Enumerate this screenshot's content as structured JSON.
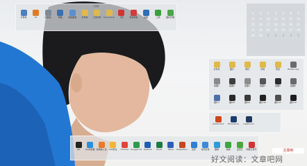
{
  "top_fence": {
    "title": "计算机",
    "icons": [
      {
        "label": "计算机",
        "icon": "computer-icon",
        "color": "#4a7fc1"
      },
      {
        "label": "IE",
        "icon": "browser-icon",
        "color": "#e27b24"
      },
      {
        "label": "回收站",
        "icon": "recycle-bin-icon",
        "color": "#7d8a96"
      },
      {
        "label": "网络",
        "icon": "network-icon",
        "color": "#3d6fb0"
      },
      {
        "label": "控制面板",
        "icon": "control-panel-icon",
        "color": "#5a8fd0"
      },
      {
        "label": "文件夹",
        "icon": "folder-icon",
        "color": "#e0b94a"
      },
      {
        "label": "工作文件",
        "icon": "folder-icon",
        "color": "#e0b94a"
      },
      {
        "label": "Documents",
        "icon": "folder-icon",
        "color": "#e0b94a"
      },
      {
        "label": "下载",
        "icon": "download-icon",
        "color": "#d33434"
      },
      {
        "label": "百度网盘",
        "icon": "cloud-icon",
        "color": "#d23c3c"
      },
      {
        "label": "画图",
        "icon": "paint-icon",
        "color": "#2f6fb3"
      },
      {
        "label": "工具",
        "icon": "tools-icon",
        "color": "#39a03d"
      },
      {
        "label": "图标管理",
        "icon": "manager-icon",
        "color": "#4aa64a"
      }
    ]
  },
  "calendar": {
    "header": "",
    "days": [
      {
        "d": "1",
        "dim": false
      },
      {
        "d": "2",
        "dim": false
      },
      {
        "d": "3",
        "dim": false
      },
      {
        "d": "4",
        "dim": false
      },
      {
        "d": "5",
        "dim": false
      },
      {
        "d": "6",
        "dim": false
      },
      {
        "d": "7",
        "dim": false
      },
      {
        "d": "8",
        "dim": false
      },
      {
        "d": "9",
        "dim": false
      },
      {
        "d": "10",
        "dim": false
      },
      {
        "d": "11",
        "dim": false
      },
      {
        "d": "12",
        "dim": false
      },
      {
        "d": "13",
        "dim": false
      },
      {
        "d": "14",
        "dim": false
      },
      {
        "d": "15",
        "dim": false
      },
      {
        "d": "16",
        "dim": false
      },
      {
        "d": "17",
        "dim": false
      },
      {
        "d": "18",
        "dim": false
      },
      {
        "d": "19",
        "dim": false
      },
      {
        "d": "20",
        "dim": false
      },
      {
        "d": "21",
        "dim": false
      },
      {
        "d": "22",
        "dim": false
      },
      {
        "d": "23",
        "dim": false
      },
      {
        "d": "24",
        "dim": false
      },
      {
        "d": "25",
        "dim": false
      },
      {
        "d": "26",
        "dim": false
      },
      {
        "d": "27",
        "dim": false
      },
      {
        "d": "28",
        "dim": false
      },
      {
        "d": "29",
        "dim": false
      },
      {
        "d": "30",
        "dim": false
      },
      {
        "d": "1",
        "dim": true
      },
      {
        "d": "2",
        "dim": true
      },
      {
        "d": "3",
        "dim": true
      },
      {
        "d": "4",
        "dim": true
      },
      {
        "d": "5",
        "dim": true
      }
    ]
  },
  "right_fence": {
    "icons": [
      {
        "label": "文件夹",
        "icon": "folder-icon",
        "color": "#e0b94a"
      },
      {
        "label": "图片",
        "icon": "folder-icon",
        "color": "#e0b94a"
      },
      {
        "label": "素材",
        "icon": "folder-icon",
        "color": "#e0b94a"
      },
      {
        "label": "文档",
        "icon": "folder-icon",
        "color": "#e0b94a"
      },
      {
        "label": "项目",
        "icon": "folder-icon",
        "color": "#e0b94a"
      },
      {
        "label": "Winter-dog",
        "icon": "image-icon",
        "color": "#6b6b6b"
      },
      {
        "label": "截图1",
        "icon": "image-icon",
        "color": "#8a8a8a"
      },
      {
        "label": "截图2",
        "icon": "image-icon",
        "color": "#3e3e3e"
      },
      {
        "label": "截图3",
        "icon": "image-icon",
        "color": "#8c8c8c"
      },
      {
        "label": "截图4",
        "icon": "image-icon",
        "color": "#555555"
      },
      {
        "label": "截图5",
        "icon": "image-icon",
        "color": "#2b2b2b"
      },
      {
        "label": "截图6",
        "icon": "image-icon",
        "color": "#6a6a6a"
      },
      {
        "label": "图片7",
        "icon": "image-icon",
        "color": "#4b6fa8"
      },
      {
        "label": "图片8",
        "icon": "image-icon",
        "color": "#2a2a2a"
      },
      {
        "label": "图片9",
        "icon": "image-icon",
        "color": "#3a3a3a"
      },
      {
        "label": "图片10",
        "icon": "image-icon",
        "color": "#222222"
      },
      {
        "label": "图片11",
        "icon": "image-icon",
        "color": "#4f4f4f"
      },
      {
        "label": "图片12",
        "icon": "image-icon",
        "color": "#1d1d1d"
      }
    ]
  },
  "mid_fence": {
    "icons": [
      {
        "label": "Adobe Illustrator",
        "icon": "illustrator-icon",
        "color": "#d0451b"
      },
      {
        "label": "Photoshop",
        "icon": "photoshop-icon",
        "color": "#1a3b6d"
      },
      {
        "label": "Lightroom",
        "icon": "lightroom-icon",
        "color": "#22395e"
      }
    ]
  },
  "bottom_fence": {
    "icons": [
      {
        "label": "QQ",
        "icon": "qq-icon",
        "color": "#222222"
      },
      {
        "label": "QQ浏览器",
        "icon": "browser-icon",
        "color": "#2a8fdc"
      },
      {
        "label": "搜狗输入法",
        "icon": "input-icon",
        "color": "#e87a2a"
      },
      {
        "label": "360安全",
        "icon": "security-icon",
        "color": "#f2b632"
      },
      {
        "label": "Chrome",
        "icon": "chrome-icon",
        "color": "#e2443a"
      },
      {
        "label": "Google Chrome",
        "icon": "chrome-icon",
        "color": "#2e9b4b"
      },
      {
        "label": "Outlook",
        "icon": "outlook-icon",
        "color": "#1f5fb3"
      },
      {
        "label": "Excel",
        "icon": "excel-icon",
        "color": "#1e7a45"
      },
      {
        "label": "Word",
        "icon": "word-icon",
        "color": "#2b5fb7"
      },
      {
        "label": "PowerPoint",
        "icon": "ppt-icon",
        "color": "#c6441f"
      },
      {
        "label": "迅雷",
        "icon": "thunder-icon",
        "color": "#2f7fd6"
      },
      {
        "label": "暴风影音",
        "icon": "player-icon",
        "color": "#3c8ad8"
      },
      {
        "label": "酷狗",
        "icon": "music-icon",
        "color": "#2f9ad8"
      },
      {
        "label": "微信",
        "icon": "wechat-icon",
        "color": "#3aa741"
      },
      {
        "label": "爱奇艺",
        "icon": "video-icon",
        "color": "#4aa63c"
      },
      {
        "label": "网易云音乐",
        "icon": "music-icon",
        "color": "#d23434"
      }
    ]
  },
  "watermark": {
    "text": "好文阅读：文章吧网"
  },
  "logo_badge": {
    "text": "文章吧"
  }
}
